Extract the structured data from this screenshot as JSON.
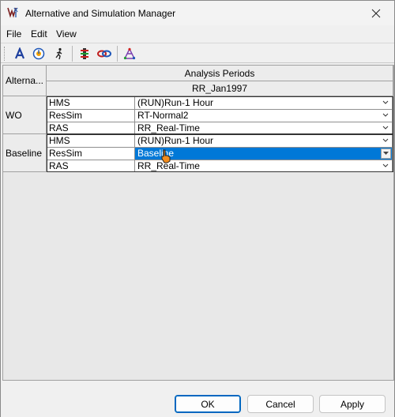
{
  "window": {
    "title": "Alternative and Simulation Manager",
    "app_icon": "wk-logo-icon"
  },
  "menu": [
    "File",
    "Edit",
    "View"
  ],
  "toolbar": {
    "buttons": [
      "font-a-icon",
      "clock-info-icon",
      "runner-icon",
      "ladder-icon",
      "link-icon",
      "network-icon"
    ]
  },
  "grid": {
    "corner_header": "Alterna...",
    "column_header": "Analysis Periods",
    "period": "RR_Jan1997",
    "alternatives": [
      {
        "name": "WO",
        "rows": [
          {
            "model": "HMS",
            "value": "(RUN)Run-1 Hour"
          },
          {
            "model": "ResSim",
            "value": "RT-Normal2"
          },
          {
            "model": "RAS",
            "value": "RR_Real-Time"
          }
        ]
      },
      {
        "name": "Baseline",
        "rows": [
          {
            "model": "HMS",
            "value": "(RUN)Run-1 Hour"
          },
          {
            "model": "ResSim",
            "value": "Baseline"
          },
          {
            "model": "RAS",
            "value": "RR_Real-Time"
          }
        ]
      }
    ]
  },
  "buttons": {
    "ok": "OK",
    "cancel": "Cancel",
    "apply": "Apply"
  },
  "colors": {
    "selection": "#0078d7",
    "default_button_border": "#0067c0"
  }
}
